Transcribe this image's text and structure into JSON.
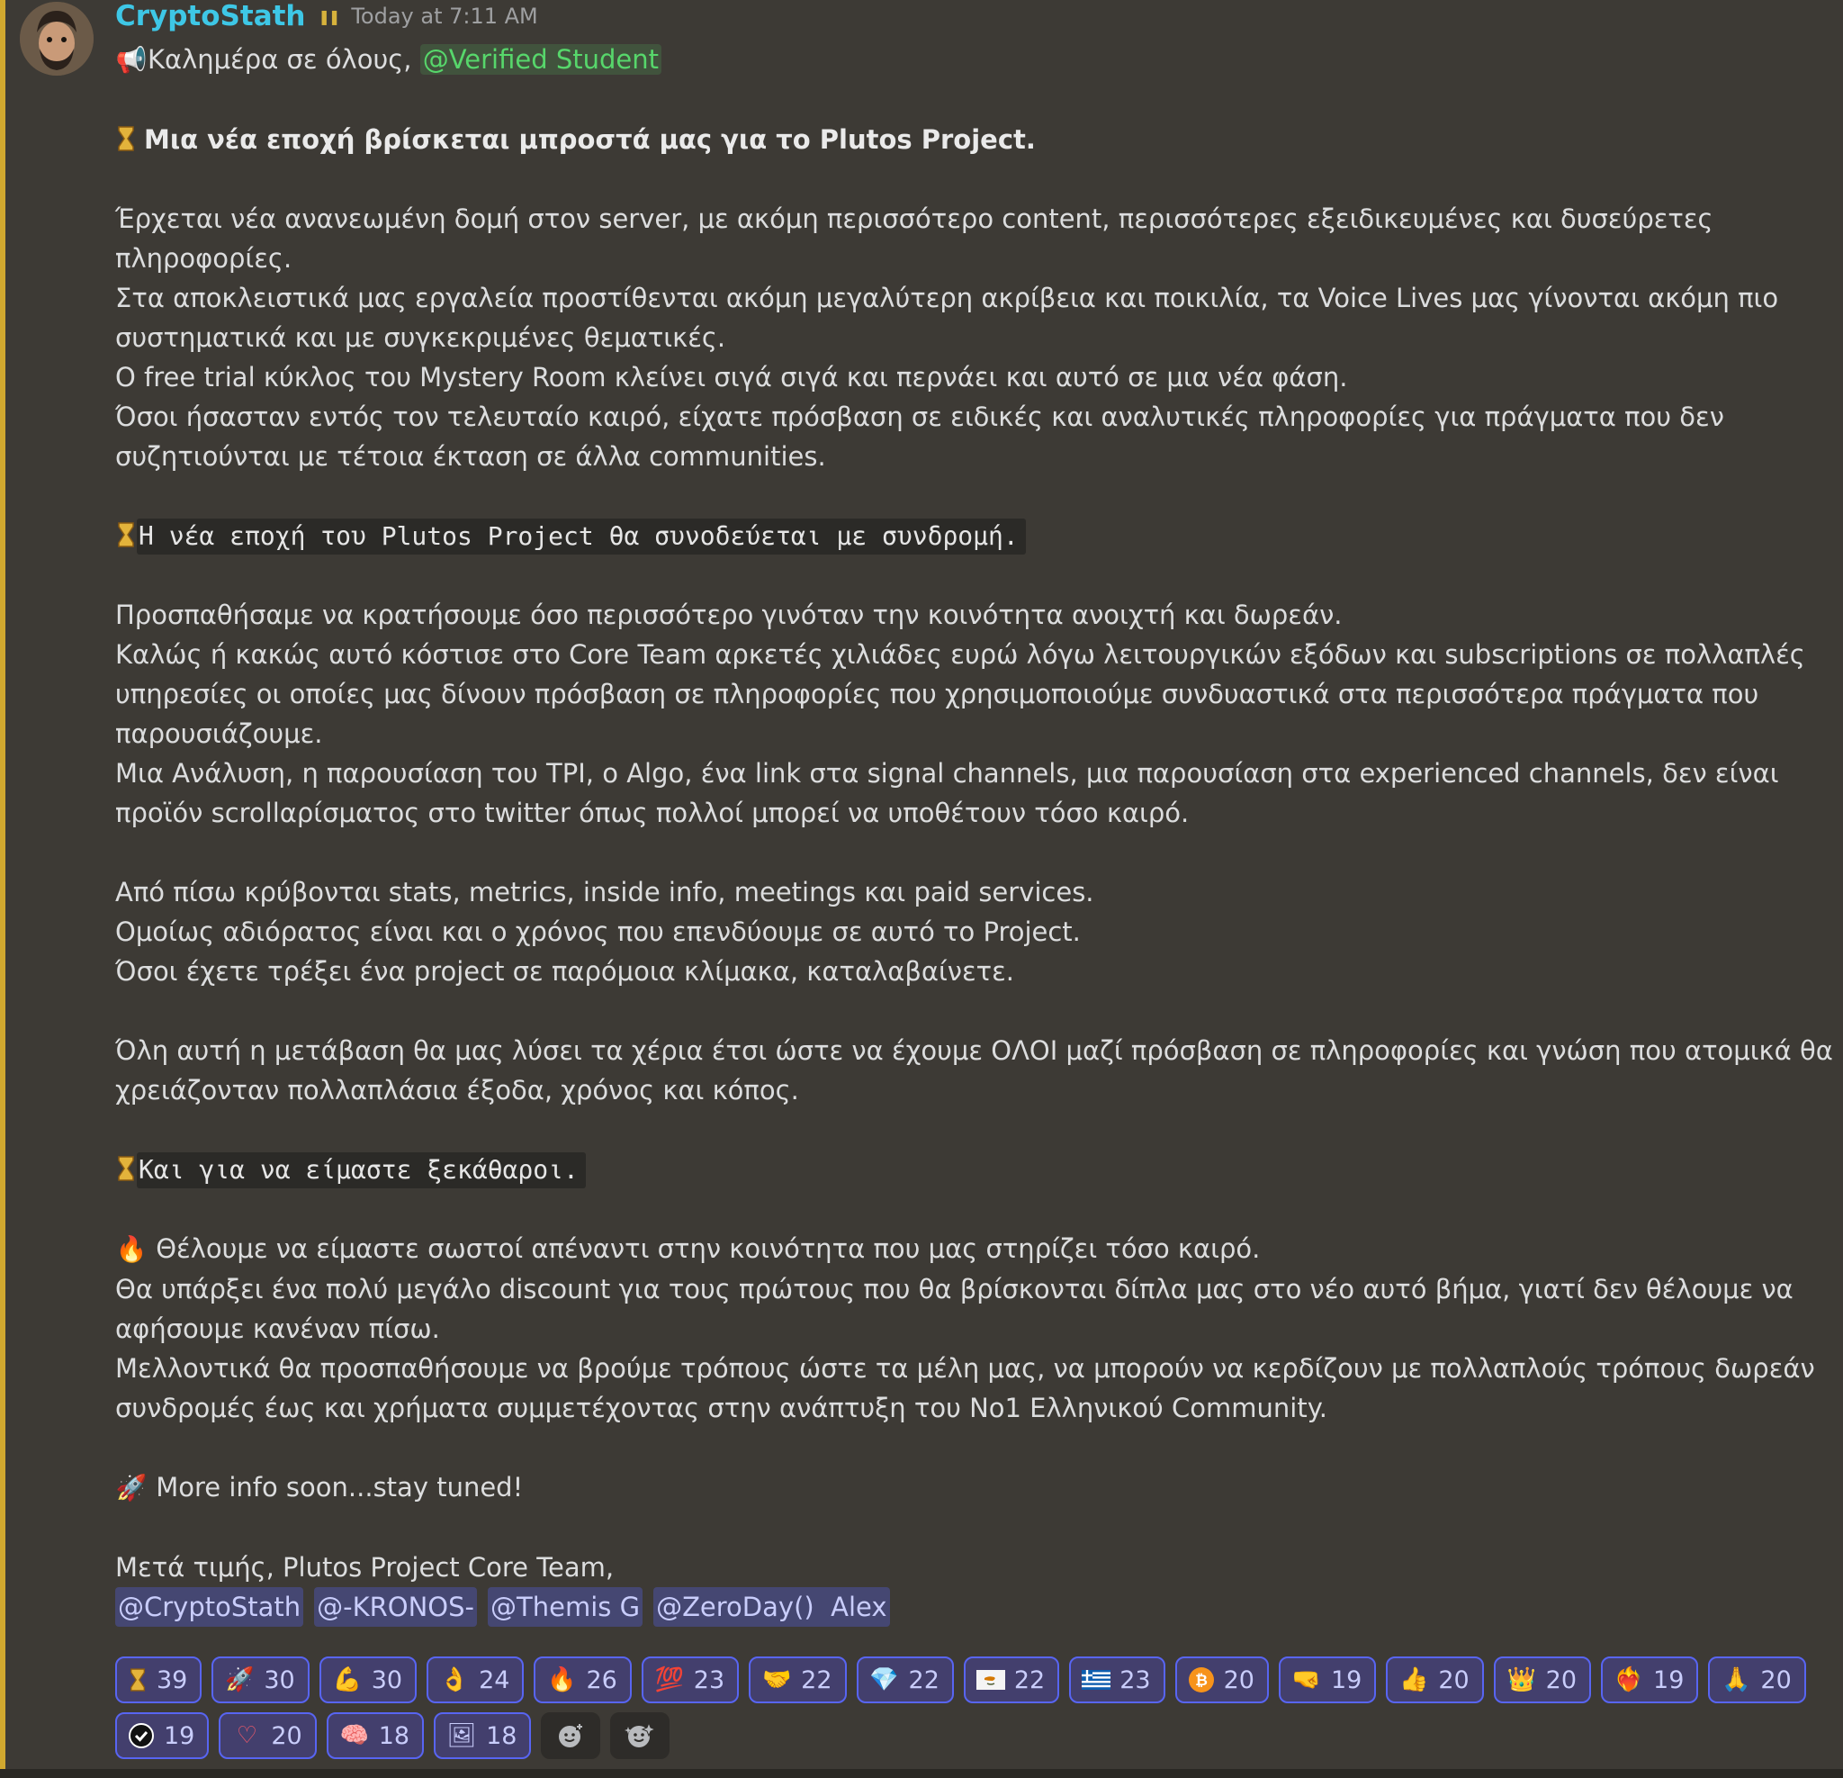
{
  "message": {
    "username": "CryptoStath",
    "timestamp": "Today at 7:11 AM",
    "greeting": "Καλημέρα σε όλους, ",
    "greeting_mention": "@Verified Student",
    "heading": "Μια νέα εποχή βρίσκεται μπροστά μας για το Plutos Project.",
    "p1_l1": " Έρχεται νέα ανανεωμένη δομή στον server, με ακόμη περισσότερο content, περισσότερες εξειδικευμένες και δυσεύρετες",
    "p1_l2": "πληροφορίες.",
    "p1_l3": "Στα αποκλειστικά μας εργαλεία προστίθενται ακόμη μεγαλύτερη ακρίβεια και ποικιλία, τα Voice Lives μας γίνονται ακόμη πιο",
    "p1_l4": "συστηματικά και με συγκεκριμένες θεματικές.",
    "p1_l5": "Ο free trial κύκλος του Mystery Room κλείνει σιγά σιγά και περνάει και αυτό σε μια νέα φάση.",
    "p1_l6": "Όσοι ήσασταν εντός τον τελευταίο καιρό, είχατε πρόσβαση σε ειδικές και αναλυτικές πληροφορίες για πράγματα που δεν",
    "p1_l7": "συζητιούνται με τέτοια έκταση σε άλλα communities.",
    "code1": "Η νέα εποχή του Plutos Project θα συνοδεύεται με συνδρομή.",
    "p2_l1": "Προσπαθήσαμε να κρατήσουμε όσο περισσότερο γινόταν την κοινότητα ανοιχτή και δωρεάν.",
    "p2_l2": "Καλώς ή κακώς αυτό κόστισε στο Core Team αρκετές χιλιάδες ευρώ λόγω λειτουργικών εξόδων και subscriptions σε πολλαπλές",
    "p2_l3": "υπηρεσίες οι οποίες μας δίνουν πρόσβαση σε πληροφορίες που χρησιμοποιούμε συνδυαστικά στα περισσότερα πράγματα που",
    "p2_l4": "παρουσιάζουμε.",
    "p2_l5": "Μια Ανάλυση, η παρουσίαση του TPI, ο Algo, ένα link στα signal channels, μια παρουσίαση στα experienced channels, δεν είναι",
    "p2_l6": "προϊόν scrollαρίσματος στο twitter όπως πολλοί μπορεί να υποθέτουν τόσο καιρό.",
    "p3_l1": "Από πίσω κρύβονται stats, metrics, inside info, meetings και paid services.",
    "p3_l2": "Ομοίως αδιόρατος είναι και ο χρόνος που επενδύουμε σε αυτό το Project.",
    "p3_l3": "Όσοι έχετε τρέξει ένα project σε παρόμοια κλίμακα, καταλαβαίνετε.",
    "p4_l1": "Όλη αυτή η μετάβαση θα μας λύσει τα χέρια έτσι ώστε να έχουμε ΟΛΟΙ μαζί πρόσβαση σε πληροφορίες και γνώση που ατομικά θα",
    "p4_l2": "χρειάζονταν πολλαπλάσια έξοδα, χρόνος και κόπος.",
    "code2": "Και για να είμαστε ξεκάθαροι.",
    "p5_l1": " Θέλουμε να είμαστε σωστοί απέναντι στην κοινότητα που μας στηρίζει τόσο καιρό.",
    "p5_l2": "Θα υπάρξει ένα πολύ μεγάλο discount για τους πρώτους που θα βρίσκονται δίπλα μας στο νέο αυτό βήμα, γιατί δεν θέλουμε να",
    "p5_l3": "αφήσουμε κανέναν πίσω.",
    "p5_l4": "Μελλοντικά θα προσπαθήσουμε να βρούμε τρόπους ώστε τα μέλη μας, να μπορούν να κερδίζουν με πολλαπλούς τρόπους δωρεάν",
    "p5_l5": "συνδρομές έως και χρήματα συμμετέχοντας στην ανάπτυξη του Νο1 Ελληνικού Community.",
    "p6_l1": " More info soon...stay tuned!",
    "signoff": "Μετά τιμής, Plutos Project Core Team,",
    "mentions": [
      "@CryptoStath",
      "@-KRONOS-",
      "@Themis G",
      "@ZeroDay()  Alex"
    ]
  },
  "reactions": [
    {
      "emoji": "⏳",
      "icon": "hourglass-icon",
      "count": "39"
    },
    {
      "emoji": "🚀",
      "icon": "rocket-icon",
      "count": "30"
    },
    {
      "emoji": "💪",
      "icon": "flexed-biceps-icon",
      "count": "30"
    },
    {
      "emoji": "👌",
      "icon": "ok-hand-icon",
      "count": "24"
    },
    {
      "emoji": "🔥",
      "icon": "fire-icon",
      "count": "26"
    },
    {
      "emoji": "💯",
      "icon": "hundred-points-icon",
      "count": "23"
    },
    {
      "emoji": "🤝",
      "icon": "handshake-icon",
      "count": "22"
    },
    {
      "emoji": "💎",
      "icon": "gem-icon",
      "count": "22"
    },
    {
      "emoji": "🇨🇾",
      "icon": "cyprus-flag-icon",
      "count": "22"
    },
    {
      "emoji": "🇬🇷",
      "icon": "greece-flag-icon",
      "count": "23"
    },
    {
      "emoji": "₿",
      "icon": "bitcoin-icon",
      "count": "20"
    },
    {
      "emoji": "🤜",
      "icon": "pointing-hand-icon",
      "count": "19"
    },
    {
      "emoji": "👍",
      "icon": "thumbs-up-icon",
      "count": "20"
    },
    {
      "emoji": "👑",
      "icon": "crown-icon",
      "count": "20"
    },
    {
      "emoji": "❤️‍🔥",
      "icon": "heart-on-fire-icon",
      "count": "19"
    },
    {
      "emoji": "🙏",
      "icon": "folded-hands-icon",
      "count": "20"
    },
    {
      "emoji": "✔",
      "icon": "check-badge-icon",
      "count": "19"
    },
    {
      "emoji": "♡",
      "icon": "heart-icon",
      "count": "20"
    },
    {
      "emoji": "🧠",
      "icon": "rainbow-brain-icon",
      "count": "18"
    },
    {
      "emoji": "🖼",
      "icon": "portrait-sticker-icon",
      "count": "18"
    }
  ],
  "colors": {
    "background": "#3d3a35",
    "accent_bar": "#d0a82f",
    "username": "#3ec7e6",
    "mention_green": "#57d76b",
    "mention_blue": "#c9cdfb",
    "reaction_border": "#5865f2"
  }
}
